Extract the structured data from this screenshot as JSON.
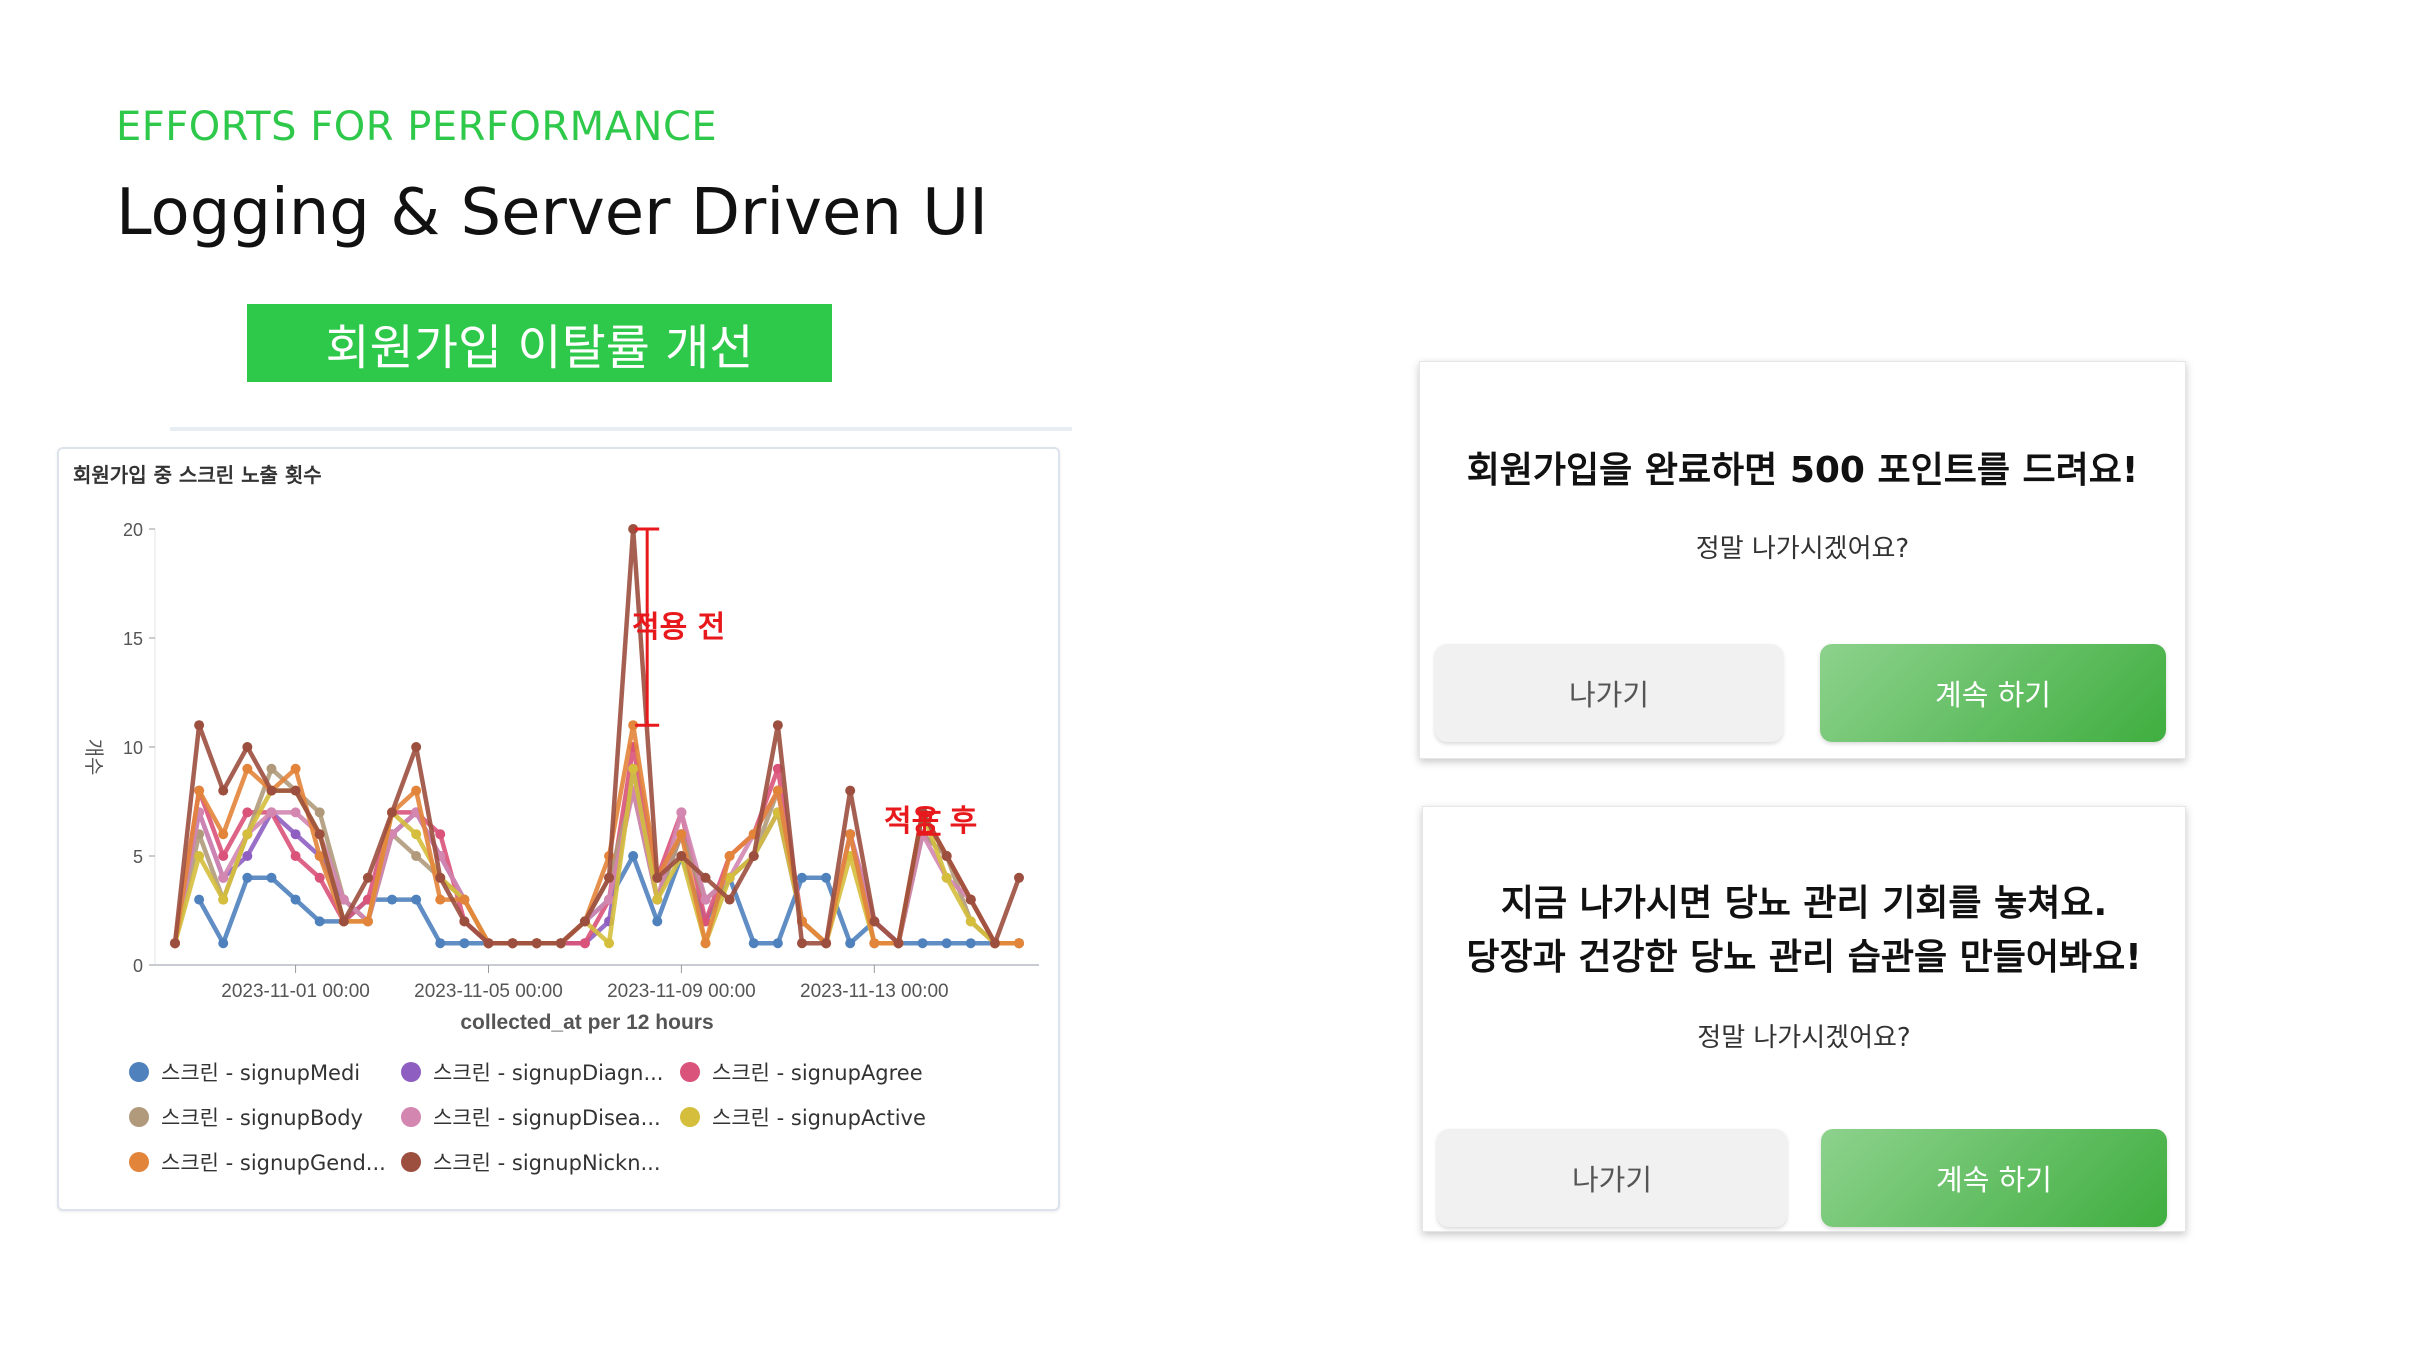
{
  "header": {
    "eyebrow": "EFFORTS FOR PERFORMANCE",
    "title": "Logging & Server Driven UI",
    "badge": "회원가입 이탈률 개선"
  },
  "annotations": {
    "before": "적용 전",
    "after": "적용 후"
  },
  "dialogs": [
    {
      "title_lines": [
        "회원가입을 완료하면 500 포인트를 드려요!"
      ],
      "subtitle": "정말 나가시겠어요?",
      "exit_label": "나가기",
      "continue_label": "계속 하기"
    },
    {
      "title_lines": [
        "지금 나가시면 당뇨 관리 기회를 놓쳐요.",
        "당장과 건강한 당뇨 관리 습관을 만들어봐요!"
      ],
      "subtitle": "정말 나가시겠어요?",
      "exit_label": "나가기",
      "continue_label": "계속 하기"
    }
  ],
  "colors": {
    "accent": "#2ec84a",
    "annotation": "#e8191c"
  },
  "chart_data": {
    "type": "line",
    "title": "회원가입 중 스크린 노출 횟수",
    "xlabel": "collected_at per 12 hours",
    "ylabel": "개수",
    "ylim": [
      0,
      20
    ],
    "yticks": [
      0,
      5,
      10,
      15,
      20
    ],
    "xticks": [
      "2023-11-01 00:00",
      "2023-11-05 00:00",
      "2023-11-09 00:00",
      "2023-11-13 00:00"
    ],
    "x_start": "2023-10-29 12:00",
    "x_step_hours": 12,
    "grid": false,
    "legend_position": "bottom",
    "series": [
      {
        "name": "스크린 - signupMedi",
        "color": "#4f81bd",
        "values": [
          null,
          3,
          1,
          4,
          4,
          3,
          2,
          2,
          3,
          3,
          3,
          1,
          1,
          1,
          1,
          1,
          1,
          2,
          3,
          5,
          2,
          5,
          2,
          4,
          1,
          1,
          4,
          4,
          1,
          2,
          1,
          1,
          1,
          1,
          1,
          1
        ]
      },
      {
        "name": "스크린 - signupDiagn...",
        "color": "#8e5fc1",
        "values": [
          1,
          7,
          4,
          5,
          7,
          6,
          5,
          3,
          2,
          6,
          7,
          5,
          3,
          1,
          1,
          1,
          1,
          1,
          2,
          9,
          3,
          6,
          3,
          4,
          5,
          7,
          2,
          1,
          6,
          2,
          1,
          6,
          5,
          3,
          1,
          1
        ]
      },
      {
        "name": "스크린 - signupAgree",
        "color": "#d9537a",
        "values": [
          1,
          8,
          5,
          7,
          7,
          5,
          4,
          2,
          3,
          7,
          7,
          6,
          2,
          1,
          1,
          1,
          1,
          1,
          3,
          10,
          4,
          7,
          2,
          5,
          6,
          9,
          2,
          1,
          6,
          2,
          1,
          7,
          5,
          3,
          1,
          1
        ]
      },
      {
        "name": "스크린 - signupBody",
        "color": "#b09a7b",
        "values": [
          1,
          6,
          3,
          6,
          9,
          8,
          7,
          3,
          2,
          6,
          5,
          4,
          3,
          1,
          1,
          1,
          1,
          2,
          4,
          8,
          3,
          6,
          3,
          4,
          5,
          8,
          2,
          1,
          6,
          1,
          1,
          6,
          5,
          2,
          1,
          1
        ]
      },
      {
        "name": "스크린 - signupDisea...",
        "color": "#d286b0",
        "values": [
          1,
          7,
          4,
          6,
          7,
          7,
          6,
          3,
          2,
          6,
          7,
          5,
          3,
          1,
          1,
          1,
          1,
          2,
          3,
          8,
          3,
          7,
          3,
          4,
          6,
          8,
          2,
          1,
          6,
          2,
          1,
          6,
          4,
          3,
          1,
          1
        ]
      },
      {
        "name": "스크린 - signupActive",
        "color": "#d4be3c",
        "values": [
          1,
          5,
          3,
          6,
          8,
          8,
          6,
          2,
          2,
          7,
          6,
          4,
          3,
          1,
          1,
          1,
          1,
          2,
          1,
          9,
          3,
          5,
          1,
          4,
          5,
          7,
          2,
          1,
          5,
          1,
          1,
          7,
          4,
          2,
          1,
          1
        ]
      },
      {
        "name": "스크린 - signupGend...",
        "color": "#e3843b",
        "values": [
          1,
          8,
          6,
          9,
          8,
          9,
          5,
          2,
          2,
          7,
          8,
          3,
          3,
          1,
          1,
          1,
          1,
          2,
          5,
          11,
          4,
          6,
          1,
          5,
          6,
          8,
          2,
          1,
          6,
          1,
          1,
          7,
          5,
          3,
          1,
          1
        ]
      },
      {
        "name": "스크린 - signupNickn...",
        "color": "#9c4f3f",
        "values": [
          1,
          11,
          8,
          10,
          8,
          8,
          6,
          2,
          4,
          7,
          10,
          4,
          2,
          1,
          1,
          1,
          1,
          2,
          4,
          20,
          4,
          5,
          4,
          3,
          5,
          11,
          1,
          1,
          8,
          2,
          1,
          7,
          5,
          3,
          1,
          4
        ]
      }
    ]
  }
}
